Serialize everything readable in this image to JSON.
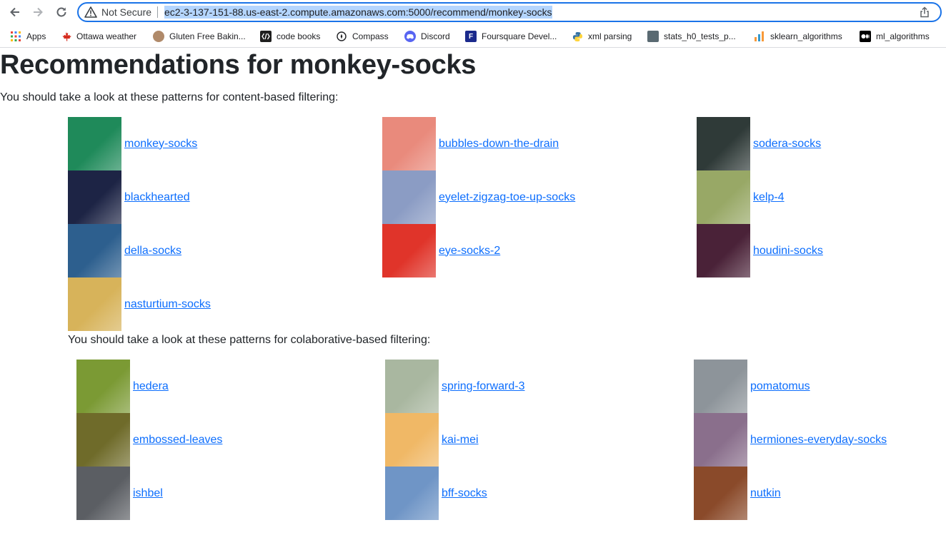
{
  "browser": {
    "security_status": "Not Secure",
    "url": "ec2-3-137-151-88.us-east-2.compute.amazonaws.com:5000/recommend/monkey-socks",
    "bookmarks": [
      {
        "label": "Apps",
        "icon": "apps-grid-icon"
      },
      {
        "label": "Ottawa weather",
        "icon": "maple-leaf-icon"
      },
      {
        "label": "Gluten Free Bakin...",
        "icon": "bakery-avatar-icon"
      },
      {
        "label": "code books",
        "icon": "code-books-icon"
      },
      {
        "label": "Compass",
        "icon": "compass-icon"
      },
      {
        "label": "Discord",
        "icon": "discord-icon"
      },
      {
        "label": "Foursquare Devel...",
        "icon": "foursquare-icon"
      },
      {
        "label": "xml parsing",
        "icon": "python-icon"
      },
      {
        "label": "stats_h0_tests_p...",
        "icon": "stats-avatar-icon"
      },
      {
        "label": "sklearn_algorithms",
        "icon": "sklearn-icon"
      },
      {
        "label": "ml_algorithms",
        "icon": "medium-icon"
      }
    ]
  },
  "page": {
    "title": "Recommendations for monkey-socks",
    "content_intro": "You should take a look at these patterns for content-based filtering:",
    "collab_intro": "You should take a look at these patterns for colaborative-based filtering:",
    "content_patterns": [
      {
        "name": "monkey-socks",
        "color": "#1f8a5a"
      },
      {
        "name": "bubbles-down-the-drain",
        "color": "#e98a7c"
      },
      {
        "name": "sodera-socks",
        "color": "#2f3a38"
      },
      {
        "name": "blackhearted",
        "color": "#1d2445"
      },
      {
        "name": "eyelet-zigzag-toe-up-socks",
        "color": "#8b9cc4"
      },
      {
        "name": "kelp-4",
        "color": "#98a866"
      },
      {
        "name": "della-socks",
        "color": "#2d5f8e"
      },
      {
        "name": "eye-socks-2",
        "color": "#e0342a"
      },
      {
        "name": "houdini-socks",
        "color": "#4a2238"
      },
      {
        "name": "nasturtium-socks",
        "color": "#d7b35a"
      }
    ],
    "collab_patterns": [
      {
        "name": "hedera",
        "color": "#7b9a34"
      },
      {
        "name": "spring-forward-3",
        "color": "#a9b7a0"
      },
      {
        "name": "pomatomus",
        "color": "#8d949a"
      },
      {
        "name": "embossed-leaves",
        "color": "#6f6b2a"
      },
      {
        "name": "kai-mei",
        "color": "#f0b866"
      },
      {
        "name": "hermiones-everyday-socks",
        "color": "#8a6f8c"
      },
      {
        "name": "ishbel",
        "color": "#5b5e63"
      },
      {
        "name": "bff-socks",
        "color": "#6f95c6"
      },
      {
        "name": "nutkin",
        "color": "#8a4a2a"
      }
    ]
  }
}
